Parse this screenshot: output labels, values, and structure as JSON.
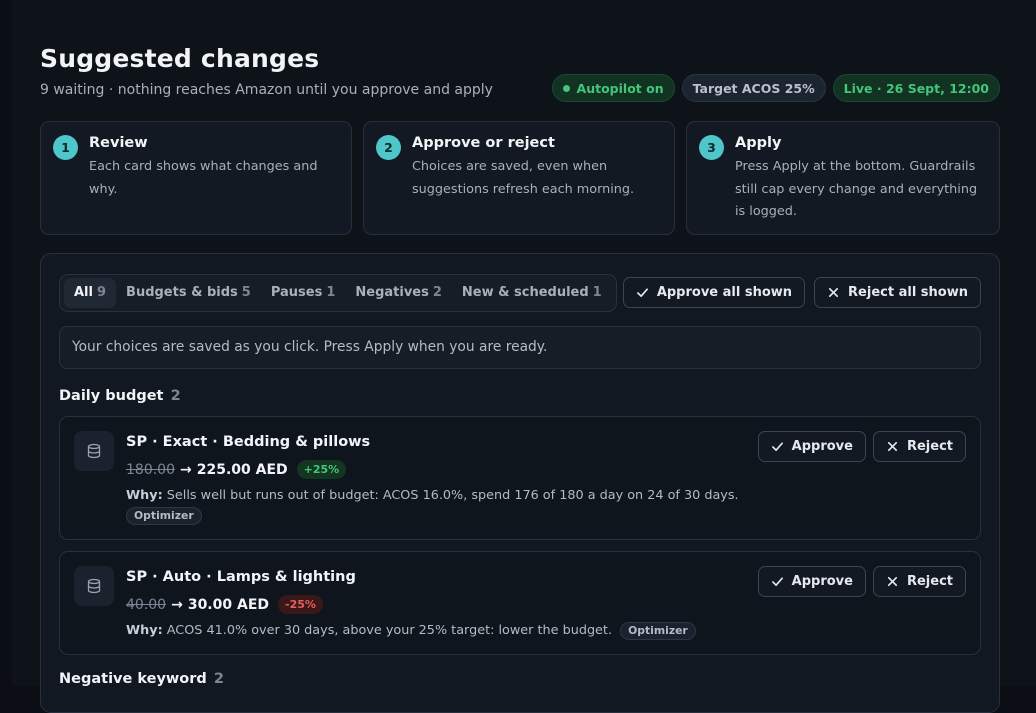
{
  "header": {
    "title": "Suggested changes",
    "subtitle": "9 waiting · nothing reaches Amazon until you approve and apply",
    "pills": {
      "autopilot": "Autopilot on",
      "target": "Target ACOS 25%",
      "live": "Live · 26 Sept, 12:00"
    }
  },
  "steps": [
    {
      "num": "1",
      "title": "Review",
      "desc": "Each card shows what changes and why."
    },
    {
      "num": "2",
      "title": "Approve or reject",
      "desc": "Choices are saved, even when suggestions refresh each morning."
    },
    {
      "num": "3",
      "title": "Apply",
      "desc": "Press Apply at the bottom. Guardrails still cap every change and everything is logged."
    }
  ],
  "filters": [
    {
      "label": "All",
      "count": "9"
    },
    {
      "label": "Budgets & bids",
      "count": "5"
    },
    {
      "label": "Pauses",
      "count": "1"
    },
    {
      "label": "Negatives",
      "count": "2"
    },
    {
      "label": "New & scheduled",
      "count": "1"
    }
  ],
  "bulk": {
    "approve_all": "Approve all shown",
    "reject_all": "Reject all shown"
  },
  "info": "Your choices are saved as you click. Press Apply when you are ready.",
  "sections": [
    {
      "title": "Daily budget",
      "count": "2",
      "cards": [
        {
          "title": "SP · Exact · Bedding & pillows",
          "old_value": "180.00",
          "arrow": "→",
          "new_value": "225.00 AED",
          "delta": "+25%",
          "why_label": "Why:",
          "why": "Sells well but runs out of budget: ACOS 16.0%, spend 176 of 180 a day on 24 of 30 days.",
          "tag": "Optimizer",
          "approve": "Approve",
          "reject": "Reject"
        },
        {
          "title": "SP · Auto · Lamps & lighting",
          "old_value": "40.00",
          "arrow": "→",
          "new_value": "30.00 AED",
          "delta": "-25%",
          "why_label": "Why:",
          "why": "ACOS 41.0% over 30 days, above your 25% target: lower the budget.",
          "tag": "Optimizer",
          "approve": "Approve",
          "reject": "Reject"
        }
      ]
    },
    {
      "title": "Negative keyword",
      "count": "2"
    }
  ],
  "colors": {
    "accent": "#4fc6c9",
    "positive": "#43c57a",
    "negative": "#e5605d",
    "background": "#0e131a"
  },
  "icons": {
    "card": "database-icon",
    "approve": "check-icon",
    "reject": "close-icon"
  }
}
